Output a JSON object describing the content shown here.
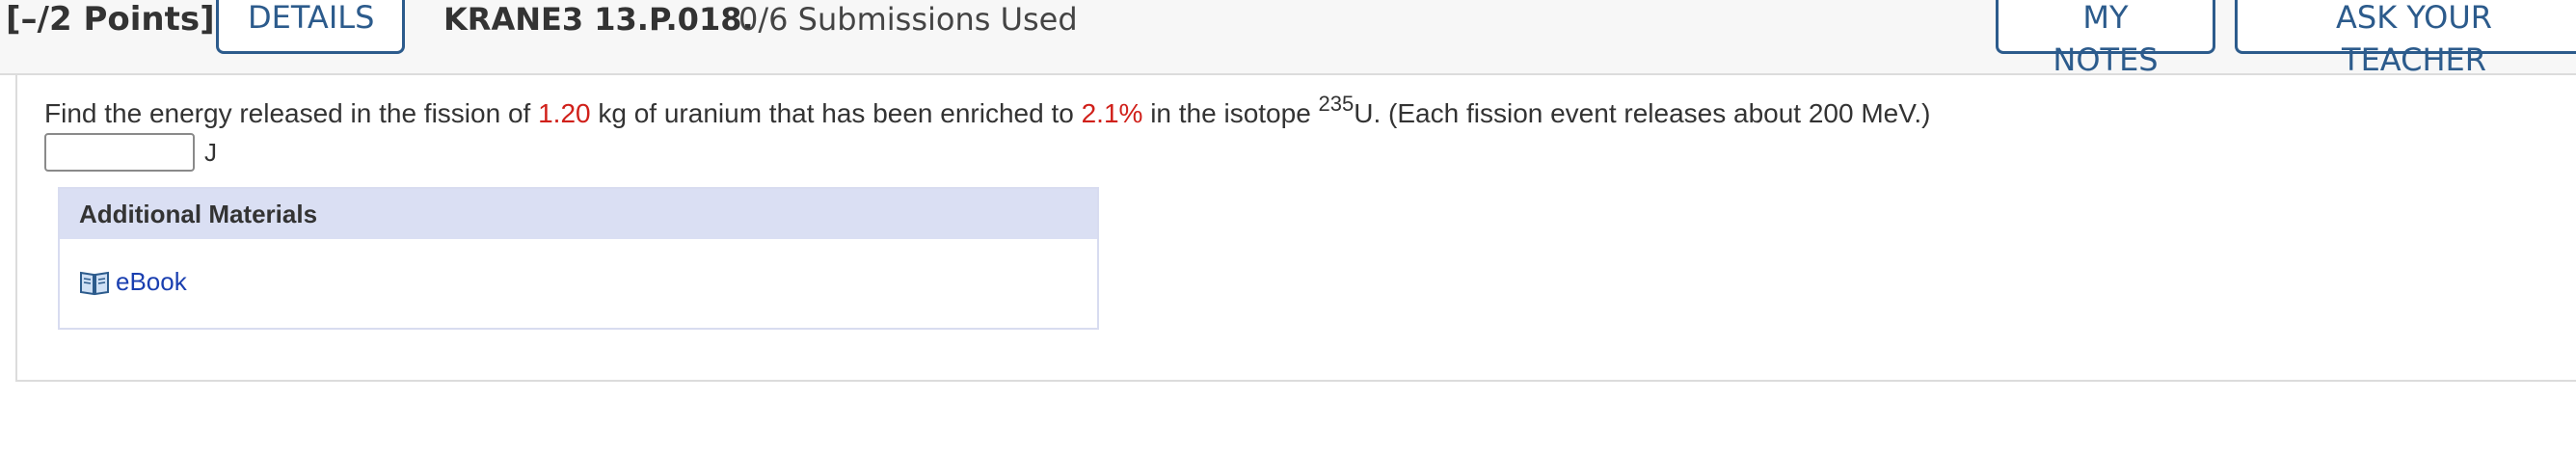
{
  "header": {
    "points": "[–/2 Points]",
    "details_label": "DETAILS",
    "question_id": "KRANE3 13.P.018.",
    "submissions": "0/6 Submissions Used",
    "my_notes_label": "MY NOTES",
    "ask_teacher_label": "ASK YOUR TEACHER"
  },
  "question": {
    "part1": "Find the energy released in the fission of ",
    "mass": "1.20",
    "part2": " kg of uranium that has been enriched to ",
    "percent": "2.1%",
    "part3": " in the isotope ",
    "isotope_mass": "235",
    "part4": "U. (Each fission event releases about 200 MeV.)",
    "answer_value": "",
    "unit": "J"
  },
  "materials": {
    "title": "Additional Materials",
    "ebook_label": "eBook",
    "ebook_icon": "book-icon"
  },
  "colors": {
    "accent": "#2c5b8c",
    "highlight_red": "#d0201a",
    "link_blue": "#1a3fb0",
    "materials_header_bg": "#dadff3"
  }
}
